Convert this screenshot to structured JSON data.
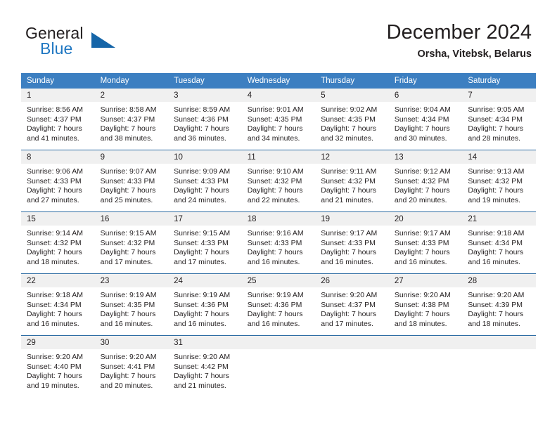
{
  "brand": {
    "name_top": "General",
    "name_bottom": "Blue",
    "triangle_color": "#1565a8",
    "blue_color": "#1f77c2"
  },
  "header": {
    "title": "December 2024",
    "subtitle": "Orsha, Vitebsk, Belarus"
  },
  "theme": {
    "header_bg": "#3c7fc1",
    "daynum_bg": "#f0f0f0",
    "row_rule": "#2e6da4",
    "text": "#231f20"
  },
  "weekdays": [
    "Sunday",
    "Monday",
    "Tuesday",
    "Wednesday",
    "Thursday",
    "Friday",
    "Saturday"
  ],
  "labels": {
    "sunrise_prefix": "Sunrise:",
    "sunset_prefix": "Sunset:",
    "daylight_prefix": "Daylight:"
  },
  "weeks": [
    [
      {
        "day": "1",
        "sunrise": "Sunrise: 8:56 AM",
        "sunset": "Sunset: 4:37 PM",
        "daylight1": "Daylight: 7 hours",
        "daylight2": "and 41 minutes."
      },
      {
        "day": "2",
        "sunrise": "Sunrise: 8:58 AM",
        "sunset": "Sunset: 4:37 PM",
        "daylight1": "Daylight: 7 hours",
        "daylight2": "and 38 minutes."
      },
      {
        "day": "3",
        "sunrise": "Sunrise: 8:59 AM",
        "sunset": "Sunset: 4:36 PM",
        "daylight1": "Daylight: 7 hours",
        "daylight2": "and 36 minutes."
      },
      {
        "day": "4",
        "sunrise": "Sunrise: 9:01 AM",
        "sunset": "Sunset: 4:35 PM",
        "daylight1": "Daylight: 7 hours",
        "daylight2": "and 34 minutes."
      },
      {
        "day": "5",
        "sunrise": "Sunrise: 9:02 AM",
        "sunset": "Sunset: 4:35 PM",
        "daylight1": "Daylight: 7 hours",
        "daylight2": "and 32 minutes."
      },
      {
        "day": "6",
        "sunrise": "Sunrise: 9:04 AM",
        "sunset": "Sunset: 4:34 PM",
        "daylight1": "Daylight: 7 hours",
        "daylight2": "and 30 minutes."
      },
      {
        "day": "7",
        "sunrise": "Sunrise: 9:05 AM",
        "sunset": "Sunset: 4:34 PM",
        "daylight1": "Daylight: 7 hours",
        "daylight2": "and 28 minutes."
      }
    ],
    [
      {
        "day": "8",
        "sunrise": "Sunrise: 9:06 AM",
        "sunset": "Sunset: 4:33 PM",
        "daylight1": "Daylight: 7 hours",
        "daylight2": "and 27 minutes."
      },
      {
        "day": "9",
        "sunrise": "Sunrise: 9:07 AM",
        "sunset": "Sunset: 4:33 PM",
        "daylight1": "Daylight: 7 hours",
        "daylight2": "and 25 minutes."
      },
      {
        "day": "10",
        "sunrise": "Sunrise: 9:09 AM",
        "sunset": "Sunset: 4:33 PM",
        "daylight1": "Daylight: 7 hours",
        "daylight2": "and 24 minutes."
      },
      {
        "day": "11",
        "sunrise": "Sunrise: 9:10 AM",
        "sunset": "Sunset: 4:32 PM",
        "daylight1": "Daylight: 7 hours",
        "daylight2": "and 22 minutes."
      },
      {
        "day": "12",
        "sunrise": "Sunrise: 9:11 AM",
        "sunset": "Sunset: 4:32 PM",
        "daylight1": "Daylight: 7 hours",
        "daylight2": "and 21 minutes."
      },
      {
        "day": "13",
        "sunrise": "Sunrise: 9:12 AM",
        "sunset": "Sunset: 4:32 PM",
        "daylight1": "Daylight: 7 hours",
        "daylight2": "and 20 minutes."
      },
      {
        "day": "14",
        "sunrise": "Sunrise: 9:13 AM",
        "sunset": "Sunset: 4:32 PM",
        "daylight1": "Daylight: 7 hours",
        "daylight2": "and 19 minutes."
      }
    ],
    [
      {
        "day": "15",
        "sunrise": "Sunrise: 9:14 AM",
        "sunset": "Sunset: 4:32 PM",
        "daylight1": "Daylight: 7 hours",
        "daylight2": "and 18 minutes."
      },
      {
        "day": "16",
        "sunrise": "Sunrise: 9:15 AM",
        "sunset": "Sunset: 4:32 PM",
        "daylight1": "Daylight: 7 hours",
        "daylight2": "and 17 minutes."
      },
      {
        "day": "17",
        "sunrise": "Sunrise: 9:15 AM",
        "sunset": "Sunset: 4:33 PM",
        "daylight1": "Daylight: 7 hours",
        "daylight2": "and 17 minutes."
      },
      {
        "day": "18",
        "sunrise": "Sunrise: 9:16 AM",
        "sunset": "Sunset: 4:33 PM",
        "daylight1": "Daylight: 7 hours",
        "daylight2": "and 16 minutes."
      },
      {
        "day": "19",
        "sunrise": "Sunrise: 9:17 AM",
        "sunset": "Sunset: 4:33 PM",
        "daylight1": "Daylight: 7 hours",
        "daylight2": "and 16 minutes."
      },
      {
        "day": "20",
        "sunrise": "Sunrise: 9:17 AM",
        "sunset": "Sunset: 4:33 PM",
        "daylight1": "Daylight: 7 hours",
        "daylight2": "and 16 minutes."
      },
      {
        "day": "21",
        "sunrise": "Sunrise: 9:18 AM",
        "sunset": "Sunset: 4:34 PM",
        "daylight1": "Daylight: 7 hours",
        "daylight2": "and 16 minutes."
      }
    ],
    [
      {
        "day": "22",
        "sunrise": "Sunrise: 9:18 AM",
        "sunset": "Sunset: 4:34 PM",
        "daylight1": "Daylight: 7 hours",
        "daylight2": "and 16 minutes."
      },
      {
        "day": "23",
        "sunrise": "Sunrise: 9:19 AM",
        "sunset": "Sunset: 4:35 PM",
        "daylight1": "Daylight: 7 hours",
        "daylight2": "and 16 minutes."
      },
      {
        "day": "24",
        "sunrise": "Sunrise: 9:19 AM",
        "sunset": "Sunset: 4:36 PM",
        "daylight1": "Daylight: 7 hours",
        "daylight2": "and 16 minutes."
      },
      {
        "day": "25",
        "sunrise": "Sunrise: 9:19 AM",
        "sunset": "Sunset: 4:36 PM",
        "daylight1": "Daylight: 7 hours",
        "daylight2": "and 16 minutes."
      },
      {
        "day": "26",
        "sunrise": "Sunrise: 9:20 AM",
        "sunset": "Sunset: 4:37 PM",
        "daylight1": "Daylight: 7 hours",
        "daylight2": "and 17 minutes."
      },
      {
        "day": "27",
        "sunrise": "Sunrise: 9:20 AM",
        "sunset": "Sunset: 4:38 PM",
        "daylight1": "Daylight: 7 hours",
        "daylight2": "and 18 minutes."
      },
      {
        "day": "28",
        "sunrise": "Sunrise: 9:20 AM",
        "sunset": "Sunset: 4:39 PM",
        "daylight1": "Daylight: 7 hours",
        "daylight2": "and 18 minutes."
      }
    ],
    [
      {
        "day": "29",
        "sunrise": "Sunrise: 9:20 AM",
        "sunset": "Sunset: 4:40 PM",
        "daylight1": "Daylight: 7 hours",
        "daylight2": "and 19 minutes."
      },
      {
        "day": "30",
        "sunrise": "Sunrise: 9:20 AM",
        "sunset": "Sunset: 4:41 PM",
        "daylight1": "Daylight: 7 hours",
        "daylight2": "and 20 minutes."
      },
      {
        "day": "31",
        "sunrise": "Sunrise: 9:20 AM",
        "sunset": "Sunset: 4:42 PM",
        "daylight1": "Daylight: 7 hours",
        "daylight2": "and 21 minutes."
      },
      {
        "day": "",
        "sunrise": "",
        "sunset": "",
        "daylight1": "",
        "daylight2": ""
      },
      {
        "day": "",
        "sunrise": "",
        "sunset": "",
        "daylight1": "",
        "daylight2": ""
      },
      {
        "day": "",
        "sunrise": "",
        "sunset": "",
        "daylight1": "",
        "daylight2": ""
      },
      {
        "day": "",
        "sunrise": "",
        "sunset": "",
        "daylight1": "",
        "daylight2": ""
      }
    ]
  ]
}
